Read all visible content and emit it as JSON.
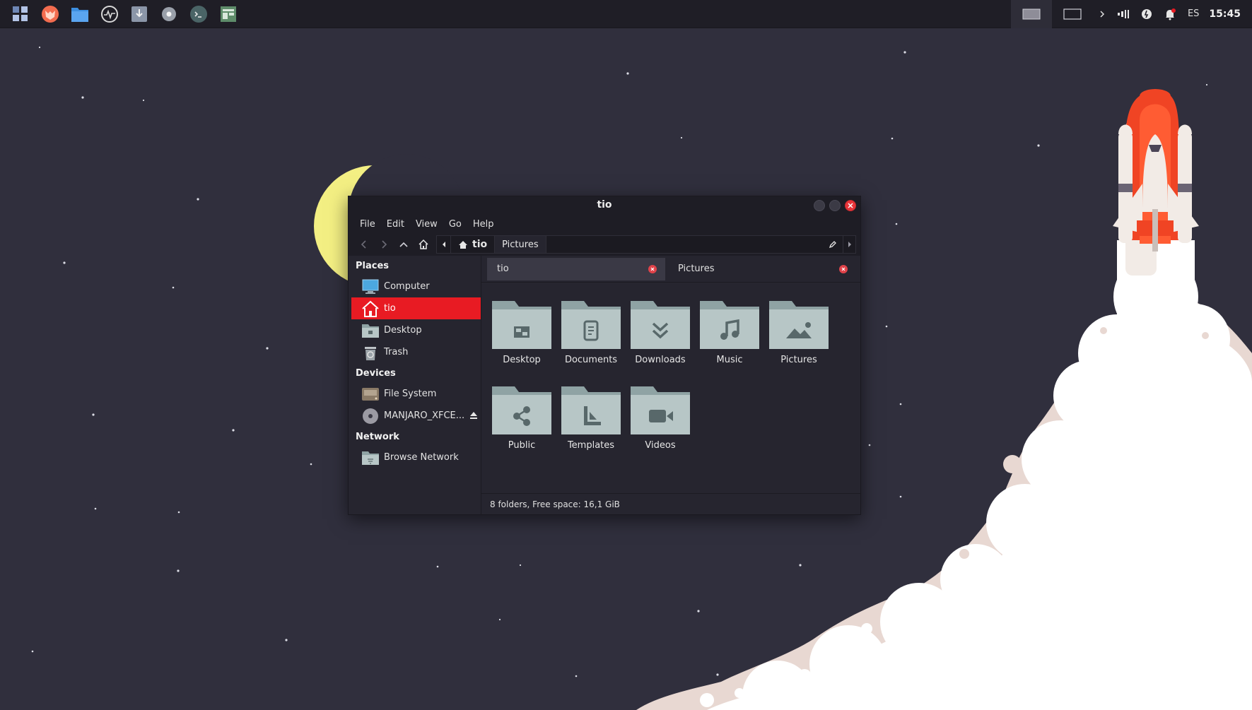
{
  "window": {
    "title": "tio",
    "menu": [
      "File",
      "Edit",
      "View",
      "Go",
      "Help"
    ]
  },
  "path": {
    "home_segment": "tio",
    "segment": "Pictures"
  },
  "sidebar": {
    "places_header": "Places",
    "places": [
      "Computer",
      "tio",
      "Desktop",
      "Trash"
    ],
    "devices_header": "Devices",
    "devices": [
      "File System",
      "MANJARO_XFCE..."
    ],
    "network_header": "Network",
    "network": [
      "Browse Network"
    ]
  },
  "tabs": [
    {
      "label": "tio",
      "active": true
    },
    {
      "label": "Pictures",
      "active": false
    }
  ],
  "folders": [
    {
      "label": "Desktop",
      "glyph": "desktop-icon"
    },
    {
      "label": "Documents",
      "glyph": "document-icon"
    },
    {
      "label": "Downloads",
      "glyph": "download-icon"
    },
    {
      "label": "Music",
      "glyph": "music-note-icon"
    },
    {
      "label": "Pictures",
      "glyph": "image-icon"
    },
    {
      "label": "Public",
      "glyph": "share-icon"
    },
    {
      "label": "Templates",
      "glyph": "template-icon"
    },
    {
      "label": "Videos",
      "glyph": "video-camera-icon"
    }
  ],
  "statusbar": {
    "text": "8 folders, Free space: 16,1 GiB"
  },
  "panel": {
    "language": "ES",
    "clock": "15:45"
  },
  "colors": {
    "accent": "#e81b23",
    "background": "#302f3d",
    "panel": "#1f1e26",
    "folder": "#b7c6c6",
    "folder_tab": "#8fa3a4"
  }
}
